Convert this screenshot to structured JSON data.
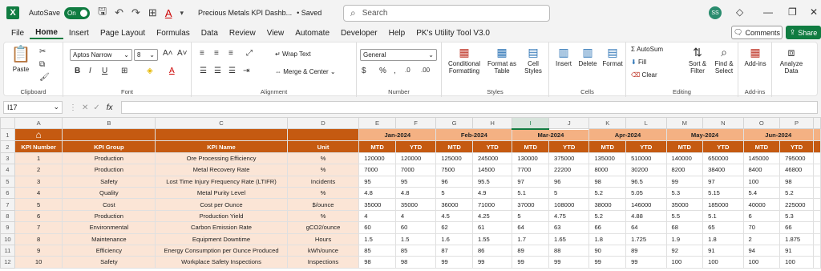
{
  "app": {
    "logo": "X",
    "autosave_label": "AutoSave",
    "autosave_state": "On",
    "doc_title": "Precious Metals KPI Dashb...",
    "saved_label": "• Saved",
    "search_placeholder": "Search",
    "user_initials": "SS"
  },
  "menu": [
    "File",
    "Home",
    "Insert",
    "Page Layout",
    "Formulas",
    "Data",
    "Review",
    "View",
    "Automate",
    "Developer",
    "Help",
    "PK's Utility Tool V3.0"
  ],
  "active_tab": "Home",
  "comments_label": "Comments",
  "share_label": "Share",
  "ribbon": {
    "clipboard": {
      "paste": "Paste",
      "label": "Clipboard"
    },
    "font": {
      "name": "Aptos Narrow",
      "size": "8",
      "label": "Font"
    },
    "alignment": {
      "wrap": "Wrap Text",
      "merge": "Merge & Center",
      "label": "Alignment"
    },
    "number": {
      "format": "General",
      "label": "Number"
    },
    "styles": {
      "cond": "Conditional Formatting",
      "fmt_table": "Format as Table",
      "cell_styles": "Cell Styles",
      "label": "Styles"
    },
    "cells": {
      "insert": "Insert",
      "delete": "Delete",
      "format": "Format",
      "label": "Cells"
    },
    "editing": {
      "autosum": "AutoSum",
      "fill": "Fill",
      "clear": "Clear",
      "sort": "Sort & Filter",
      "find": "Find & Select",
      "label": "Editing"
    },
    "addins": {
      "addins": "Add-ins",
      "label": "Add-ins"
    },
    "analyze": {
      "label": "Analyze Data"
    }
  },
  "namebox": "I17",
  "columns": [
    "A",
    "B",
    "C",
    "D",
    "E",
    "F",
    "G",
    "H",
    "I",
    "J",
    "K",
    "L",
    "M",
    "N",
    "O",
    "P"
  ],
  "selected_column": "I",
  "rows": [
    "1",
    "2",
    "3",
    "4",
    "5",
    "6",
    "7",
    "8",
    "9",
    "10",
    "11",
    "12"
  ],
  "months": [
    "Jan-2024",
    "Feb-2024",
    "Mar-2024",
    "Apr-2024",
    "May-2024",
    "Jun-2024"
  ],
  "headers": [
    "KPI Number",
    "KPI Group",
    "KPI Name",
    "Unit"
  ],
  "sub_headers": [
    "MTD",
    "YTD"
  ],
  "kpis": [
    {
      "num": "1",
      "group": "Production",
      "name": "Ore Processing Efficiency",
      "unit": "%",
      "vals": [
        "120000",
        "120000",
        "125000",
        "245000",
        "130000",
        "375000",
        "135000",
        "510000",
        "140000",
        "650000",
        "145000",
        "795000"
      ]
    },
    {
      "num": "2",
      "group": "Production",
      "name": "Metal Recovery Rate",
      "unit": "%",
      "vals": [
        "7000",
        "7000",
        "7500",
        "14500",
        "7700",
        "22200",
        "8000",
        "30200",
        "8200",
        "38400",
        "8400",
        "46800"
      ]
    },
    {
      "num": "3",
      "group": "Safety",
      "name": "Lost Time Injury Frequency Rate (LTIFR)",
      "unit": "Incidents",
      "vals": [
        "95",
        "95",
        "96",
        "95.5",
        "97",
        "96",
        "98",
        "96.5",
        "99",
        "97",
        "100",
        "98"
      ]
    },
    {
      "num": "4",
      "group": "Quality",
      "name": "Metal Purity Level",
      "unit": "%",
      "vals": [
        "4.8",
        "4.8",
        "5",
        "4.9",
        "5.1",
        "5",
        "5.2",
        "5.05",
        "5.3",
        "5.15",
        "5.4",
        "5.2"
      ]
    },
    {
      "num": "5",
      "group": "Cost",
      "name": "Cost per Ounce",
      "unit": "$/ounce",
      "vals": [
        "35000",
        "35000",
        "36000",
        "71000",
        "37000",
        "108000",
        "38000",
        "146000",
        "35000",
        "185000",
        "40000",
        "225000"
      ]
    },
    {
      "num": "6",
      "group": "Production",
      "name": "Production Yield",
      "unit": "%",
      "vals": [
        "4",
        "4",
        "4.5",
        "4.25",
        "5",
        "4.75",
        "5.2",
        "4.88",
        "5.5",
        "5.1",
        "6",
        "5.3"
      ]
    },
    {
      "num": "7",
      "group": "Environmental",
      "name": "Carbon Emission Rate",
      "unit": "gCO2/ounce",
      "vals": [
        "60",
        "60",
        "62",
        "61",
        "64",
        "63",
        "66",
        "64",
        "68",
        "65",
        "70",
        "66"
      ]
    },
    {
      "num": "8",
      "group": "Maintenance",
      "name": "Equipment Downtime",
      "unit": "Hours",
      "vals": [
        "1.5",
        "1.5",
        "1.6",
        "1.55",
        "1.7",
        "1.65",
        "1.8",
        "1.725",
        "1.9",
        "1.8",
        "2",
        "1.875"
      ]
    },
    {
      "num": "9",
      "group": "Efficiency",
      "name": "Energy Consumption per Ounce Produced",
      "unit": "kWh/ounce",
      "vals": [
        "85",
        "85",
        "87",
        "86",
        "89",
        "88",
        "90",
        "89",
        "92",
        "91",
        "94",
        "91"
      ]
    },
    {
      "num": "10",
      "group": "Safety",
      "name": "Workplace Safety Inspections",
      "unit": "Inspections",
      "vals": [
        "98",
        "98",
        "99",
        "99",
        "99",
        "99",
        "99",
        "99",
        "100",
        "100",
        "100",
        "100"
      ]
    }
  ]
}
